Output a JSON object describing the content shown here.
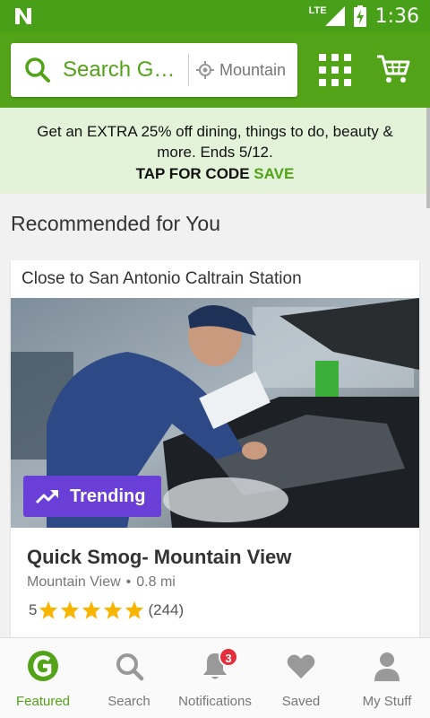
{
  "status_bar": {
    "network": "LTE",
    "time": "1:36"
  },
  "header": {
    "search_placeholder": "Search Gr…",
    "location": "Mountain"
  },
  "promo": {
    "text": "Get an EXTRA 25% off dining, things to do, beauty & more. Ends 5/12.",
    "cta_prefix": "TAP FOR CODE",
    "cta_code": "SAVE"
  },
  "section": {
    "title": "Recommended for You"
  },
  "card": {
    "context": "Close to San Antonio Caltrain Station",
    "badge": "Trending",
    "title": "Quick Smog- Mountain View",
    "location": "Mountain View",
    "separator": "•",
    "distance": "0.8 mi",
    "rating_value": "5",
    "rating_stars": 5,
    "review_count": "(244)"
  },
  "bottom_nav": {
    "items": [
      {
        "label": "Featured"
      },
      {
        "label": "Search"
      },
      {
        "label": "Notifications",
        "badge": "3"
      },
      {
        "label": "Saved"
      },
      {
        "label": "My Stuff"
      }
    ]
  },
  "colors": {
    "brand_green": "#53a318",
    "trending_purple": "#6a3fd8",
    "badge_red": "#e42e3b",
    "star_gold": "#f7b500"
  }
}
